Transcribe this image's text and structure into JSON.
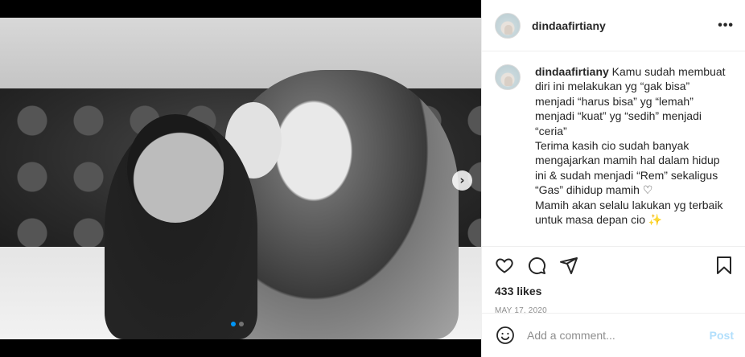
{
  "post": {
    "username": "dindaafirtiany",
    "caption_user": "dindaafirtiany",
    "caption_text": " Kamu sudah membuat\ndiri ini melakukan yg “gak bisa”\nmenjadi “harus bisa” yg “lemah”\nmenjadi “kuat” yg “sedih” menjadi\n“ceria”\nTerima kasih cio sudah banyak\nmengajarkan mamih hal dalam hidup\nini & sudah menjadi “Rem” sekaligus\n“Gas” dihidup mamih ♡\nMamih akan selalu lakukan yg terbaik\nuntuk masa depan cio ✨",
    "likes": "433 likes",
    "date": "MAY 17, 2020",
    "carousel": {
      "count": 2,
      "active_index": 0
    }
  },
  "header": {
    "more_icon": "more-horizontal-icon",
    "more_glyph": "•••"
  },
  "actions": {
    "like_icon": "heart-icon",
    "comment_icon": "comment-icon",
    "share_icon": "paper-plane-icon",
    "save_icon": "bookmark-icon"
  },
  "comment": {
    "placeholder": "Add a comment...",
    "post_label": "Post",
    "emoji_icon": "smiley-icon"
  },
  "carousel_nav": {
    "next_glyph": "›",
    "icon": "chevron-right-icon"
  },
  "colors": {
    "accent_blue": "#0095f6",
    "post_disabled": "#b2dffc",
    "text": "#262626",
    "muted": "#8e8e8e"
  }
}
